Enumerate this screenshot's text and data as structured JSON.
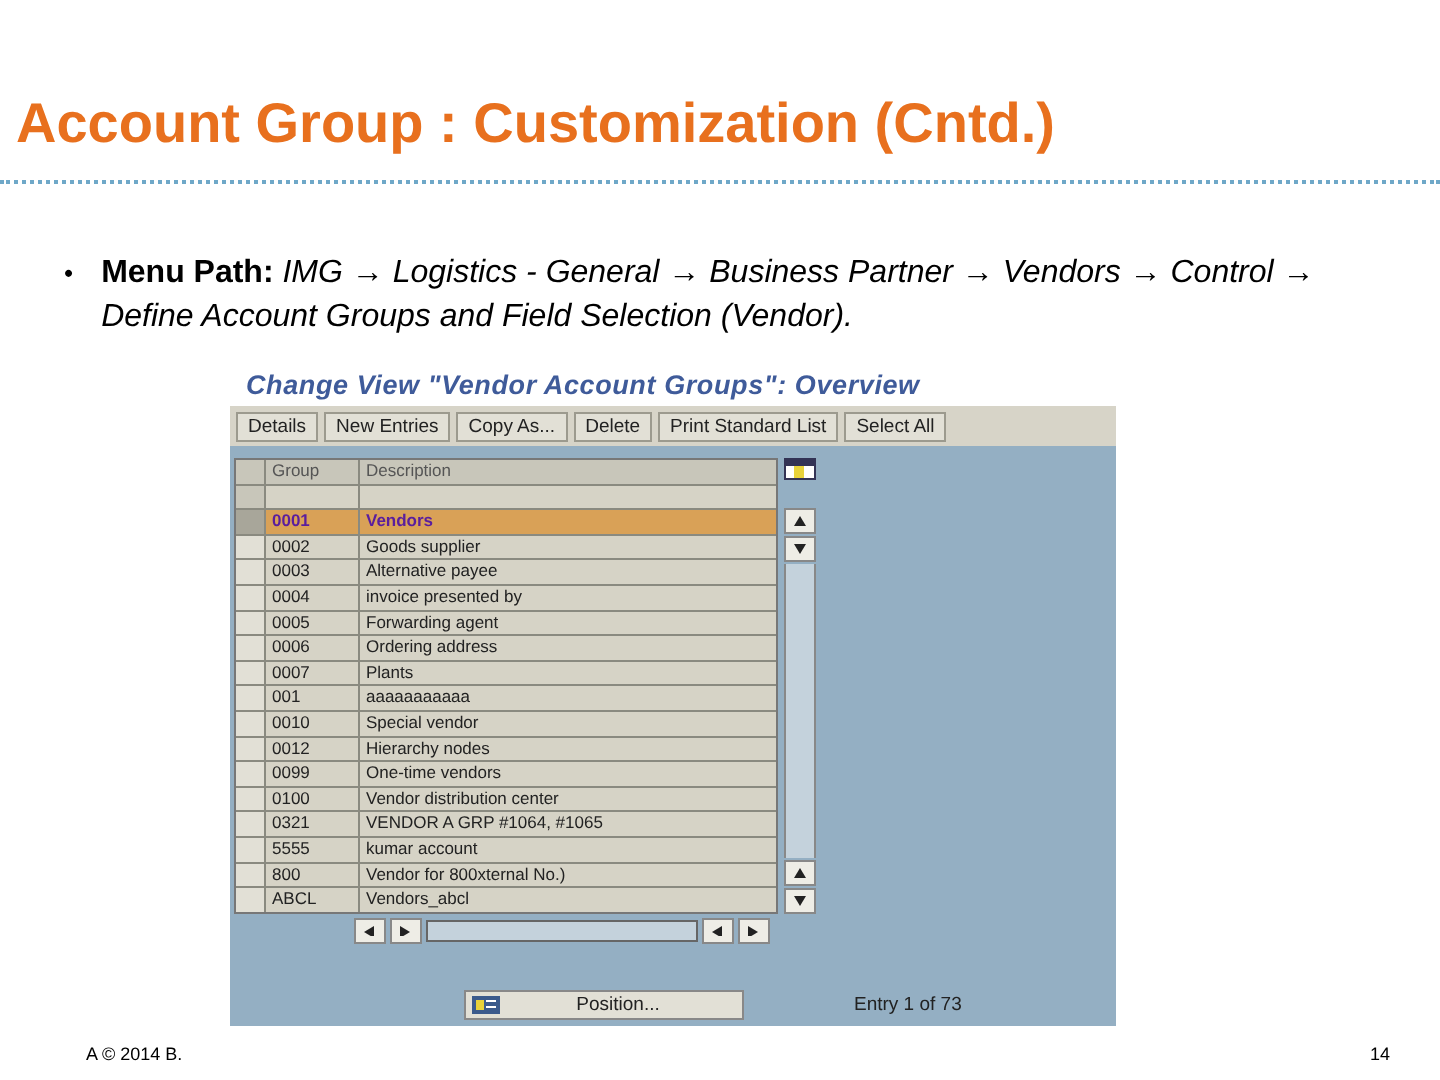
{
  "slide_title": "Account Group : Customization (Cntd.)",
  "bullet": {
    "mark": "•",
    "text": "**Menu Path:** *IMG → Logistics - General → Business Partner → Vendors → Control → Define Account Groups and Field Selection (Vendor).*"
  },
  "sap_window": {
    "title": "Change View \"Vendor Account Groups\": Overview",
    "toolbar": [
      "Details",
      "New Entries",
      "Copy As...",
      "Delete",
      "Print Standard List",
      "Select All"
    ],
    "table": {
      "columns": [
        "Group",
        "Description"
      ],
      "rows": [
        {
          "group": "0001",
          "description": "Vendors",
          "selected": true
        },
        {
          "group": "0002",
          "description": "Goods supplier",
          "selected": false
        },
        {
          "group": "0003",
          "description": "Alternative payee",
          "selected": false
        },
        {
          "group": "0004",
          "description": "invoice presented by",
          "selected": false
        },
        {
          "group": "0005",
          "description": "Forwarding agent",
          "selected": false
        },
        {
          "group": "0006",
          "description": "Ordering address",
          "selected": false
        },
        {
          "group": "0007",
          "description": "Plants",
          "selected": false
        },
        {
          "group": "001",
          "description": "aaaaaaaaaaa",
          "selected": false
        },
        {
          "group": "0010",
          "description": "Special vendor",
          "selected": false
        },
        {
          "group": "0012",
          "description": "Hierarchy nodes",
          "selected": false
        },
        {
          "group": "0099",
          "description": "One-time vendors",
          "selected": false
        },
        {
          "group": "0100",
          "description": "Vendor distribution center",
          "selected": false
        },
        {
          "group": "0321",
          "description": "VENDOR A GRP #1064, #1065",
          "selected": false
        },
        {
          "group": "5555",
          "description": "kumar account",
          "selected": false
        },
        {
          "group": "800",
          "description": "Vendor for 800xternal No.)",
          "selected": false
        },
        {
          "group": "ABCL",
          "description": "Vendors_abcl",
          "selected": false
        }
      ]
    },
    "position_button": "Position...",
    "entry_count": "Entry 1 of 73"
  },
  "footer": {
    "copyright": "A © 2014 B.",
    "page_number": "14"
  }
}
